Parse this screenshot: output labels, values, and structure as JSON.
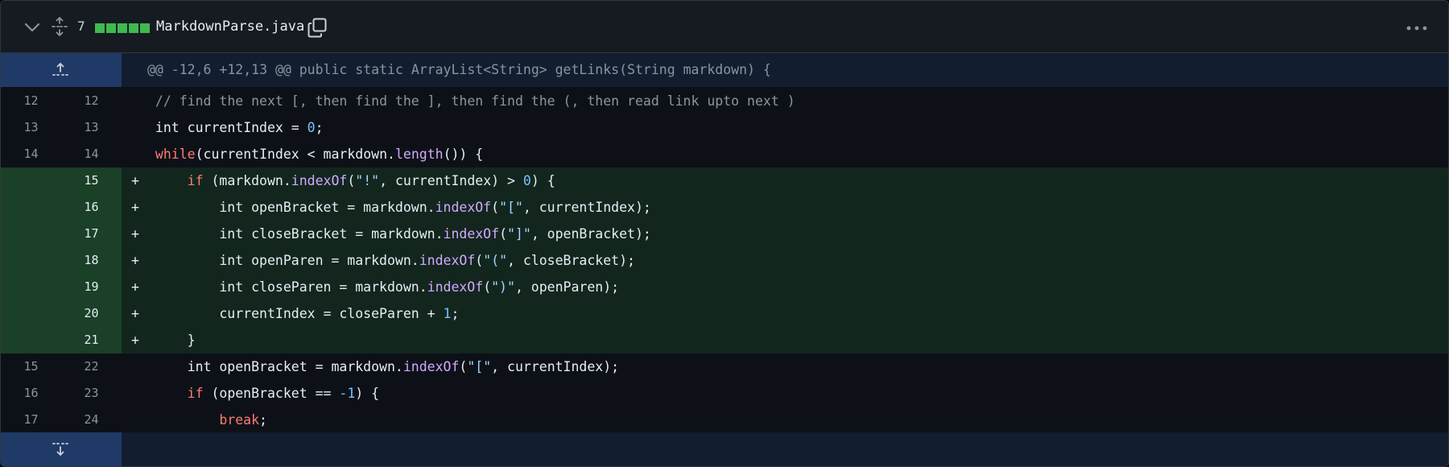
{
  "file": {
    "changes_count": "7",
    "diffstat": [
      "#3fb950",
      "#3fb950",
      "#3fb950",
      "#3fb950",
      "#3fb950"
    ],
    "name": "MarkdownParse.java"
  },
  "hunk": {
    "header": "@@ -12,6 +12,13 @@ public static ArrayList<String> getLinks(String markdown) {"
  },
  "lines": [
    {
      "old": "12",
      "new": "12",
      "type": "context",
      "indent": 8,
      "tokens": [
        {
          "t": "// find the next [, then find the ], then find the (, then read link upto next )",
          "c": "cm"
        }
      ]
    },
    {
      "old": "13",
      "new": "13",
      "type": "context",
      "indent": 8,
      "tokens": [
        {
          "t": "int currentIndex = "
        },
        {
          "t": "0",
          "c": "num"
        },
        {
          "t": ";"
        }
      ]
    },
    {
      "old": "14",
      "new": "14",
      "type": "context",
      "indent": 8,
      "tokens": [
        {
          "t": "while",
          "c": "kw"
        },
        {
          "t": "(currentIndex < markdown."
        },
        {
          "t": "length",
          "c": "fn"
        },
        {
          "t": "()) {"
        }
      ]
    },
    {
      "old": "",
      "new": "15",
      "type": "add",
      "indent": 12,
      "tokens": [
        {
          "t": "if",
          "c": "kw"
        },
        {
          "t": " (markdown."
        },
        {
          "t": "indexOf",
          "c": "fn"
        },
        {
          "t": "("
        },
        {
          "t": "\"!\"",
          "c": "str"
        },
        {
          "t": ", currentIndex) > "
        },
        {
          "t": "0",
          "c": "num"
        },
        {
          "t": ") {"
        }
      ]
    },
    {
      "old": "",
      "new": "16",
      "type": "add",
      "indent": 16,
      "tokens": [
        {
          "t": "int openBracket = markdown."
        },
        {
          "t": "indexOf",
          "c": "fn"
        },
        {
          "t": "("
        },
        {
          "t": "\"[\"",
          "c": "str"
        },
        {
          "t": ", currentIndex);"
        }
      ]
    },
    {
      "old": "",
      "new": "17",
      "type": "add",
      "indent": 16,
      "tokens": [
        {
          "t": "int closeBracket = markdown."
        },
        {
          "t": "indexOf",
          "c": "fn"
        },
        {
          "t": "("
        },
        {
          "t": "\"]\"",
          "c": "str"
        },
        {
          "t": ", openBracket);"
        }
      ]
    },
    {
      "old": "",
      "new": "18",
      "type": "add",
      "indent": 16,
      "tokens": [
        {
          "t": "int openParen = markdown."
        },
        {
          "t": "indexOf",
          "c": "fn"
        },
        {
          "t": "("
        },
        {
          "t": "\"(\"",
          "c": "str"
        },
        {
          "t": ", closeBracket);"
        }
      ]
    },
    {
      "old": "",
      "new": "19",
      "type": "add",
      "indent": 16,
      "tokens": [
        {
          "t": "int closeParen = markdown."
        },
        {
          "t": "indexOf",
          "c": "fn"
        },
        {
          "t": "("
        },
        {
          "t": "\")\"",
          "c": "str"
        },
        {
          "t": ", openParen);"
        }
      ]
    },
    {
      "old": "",
      "new": "20",
      "type": "add",
      "indent": 16,
      "tokens": [
        {
          "t": "currentIndex = closeParen + "
        },
        {
          "t": "1",
          "c": "num"
        },
        {
          "t": ";"
        }
      ]
    },
    {
      "old": "",
      "new": "21",
      "type": "add",
      "indent": 12,
      "tokens": [
        {
          "t": "}"
        }
      ]
    },
    {
      "old": "15",
      "new": "22",
      "type": "context",
      "indent": 12,
      "tokens": [
        {
          "t": "int openBracket = markdown."
        },
        {
          "t": "indexOf",
          "c": "fn"
        },
        {
          "t": "("
        },
        {
          "t": "\"[\"",
          "c": "str"
        },
        {
          "t": ", currentIndex);"
        }
      ]
    },
    {
      "old": "16",
      "new": "23",
      "type": "context",
      "indent": 12,
      "tokens": [
        {
          "t": "if",
          "c": "kw"
        },
        {
          "t": " (openBracket == "
        },
        {
          "t": "-1",
          "c": "num"
        },
        {
          "t": ") {"
        }
      ]
    },
    {
      "old": "17",
      "new": "24",
      "type": "context",
      "indent": 16,
      "tokens": [
        {
          "t": "break",
          "c": "kw"
        },
        {
          "t": ";"
        }
      ]
    }
  ],
  "add_marker": "+",
  "icons": {
    "collapse": "chevron-down-icon",
    "expand_all": "unfold-icon",
    "copy": "copy-icon",
    "more": "kebab-horizontal-icon",
    "expand_up": "expand-up-icon",
    "expand_down": "expand-down-icon"
  }
}
